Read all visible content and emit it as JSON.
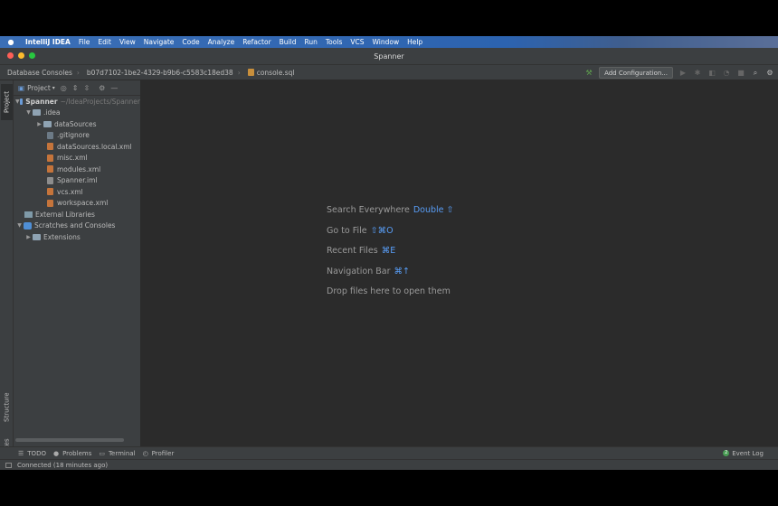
{
  "menubar": {
    "app": "IntelliJ IDEA",
    "items": [
      "File",
      "Edit",
      "View",
      "Navigate",
      "Code",
      "Analyze",
      "Refactor",
      "Build",
      "Run",
      "Tools",
      "VCS",
      "Window",
      "Help"
    ]
  },
  "window": {
    "title": "Spanner"
  },
  "navbar": {
    "crumbs": [
      "Database Consoles",
      "b07d7102-1be2-4329-b9b6-c5583c18ed38",
      "console.sql"
    ],
    "add_configuration": "Add Configuration..."
  },
  "left_stripe": {
    "project_tab": "Project",
    "structure_tab": "Structure",
    "favorites_tab": "Favorites"
  },
  "project": {
    "dropdown_label": "Project",
    "root": {
      "name": "Spanner",
      "path": "~/IdeaProjects/Spanner"
    },
    "tree": {
      "idea": ".idea",
      "dataSources": "dataSources",
      "gitignore": ".gitignore",
      "dataSourcesLocal": "dataSources.local.xml",
      "misc": "misc.xml",
      "modules": "modules.xml",
      "spannerIml": "Spanner.iml",
      "vcs": "vcs.xml",
      "workspace": "workspace.xml",
      "externalLibraries": "External Libraries",
      "scratches": "Scratches and Consoles",
      "extensions": "Extensions"
    }
  },
  "editor_hints": {
    "search_label": "Search Everywhere",
    "search_key": "Double ⇧",
    "goto_label": "Go to File",
    "goto_key": "⇧⌘O",
    "recent_label": "Recent Files",
    "recent_key": "⌘E",
    "navbar_label": "Navigation Bar",
    "navbar_key": "⌘↑",
    "drop_label": "Drop files here to open them"
  },
  "bottom_tools": {
    "todo": "TODO",
    "problems": "Problems",
    "terminal": "Terminal",
    "profiler": "Profiler",
    "event_log": "Event Log",
    "event_count": "2"
  },
  "status": {
    "text": "Connected (18 minutes ago)"
  }
}
